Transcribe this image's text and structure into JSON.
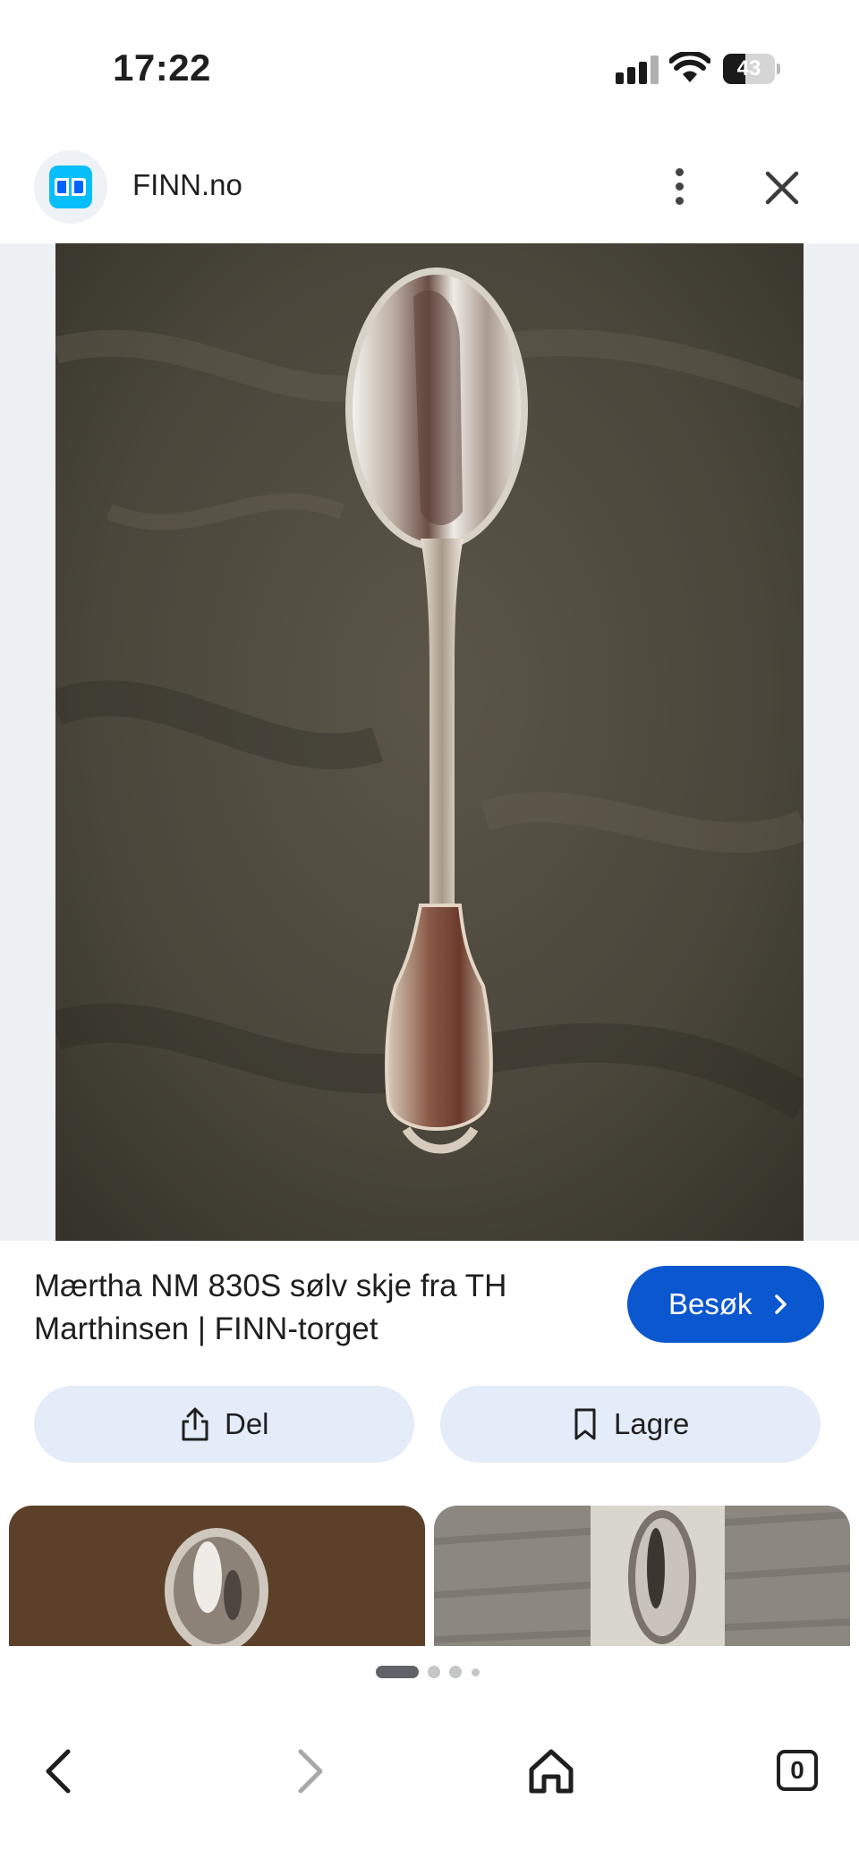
{
  "status_bar": {
    "time": "17:22",
    "battery_percent": "43",
    "signal_bars": 4,
    "signal_bars_active": 3
  },
  "header": {
    "site_name": "FINN.no",
    "site_icon": "finn-logo-icon",
    "menu_icon": "more-vert-icon",
    "close_icon": "close-icon"
  },
  "result": {
    "title": "Mærtha NM 830S sølv skje fra TH Marthinsen | FINN-torget",
    "visit_label": "Besøk"
  },
  "actions": {
    "share_label": "Del",
    "save_label": "Lagre"
  },
  "pager": {
    "active_index": 0,
    "count": 4
  },
  "bottom_nav": {
    "back_icon": "chevron-left-icon",
    "forward_icon": "chevron-right-icon",
    "home_icon": "home-icon",
    "tab_count": "0"
  },
  "colors": {
    "accent": "#0b57d0",
    "chip_bg": "#e4ecf9",
    "image_bg": "#eef1f4"
  }
}
